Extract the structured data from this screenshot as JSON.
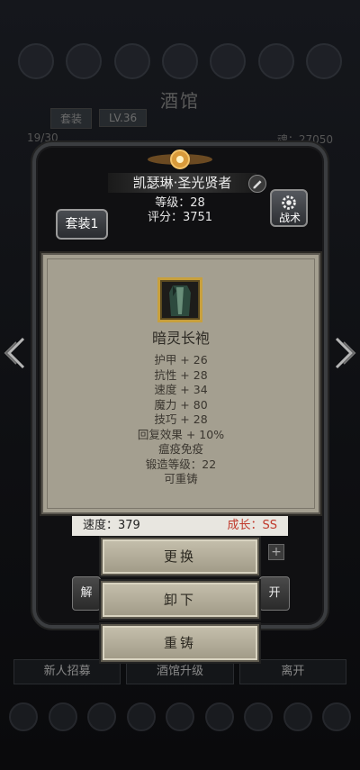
{
  "background": {
    "title": "酒馆",
    "tab_label": "套装",
    "level_badge": "LV.36",
    "count": "19/30",
    "soul": "魂：27050",
    "bottom_buttons": [
      "新人招募",
      "酒馆升级",
      "离开"
    ]
  },
  "hero": {
    "name": "凯瑟琳·圣光贤者",
    "level": "等级：28",
    "score": "评分：3751",
    "set_button": "套装1",
    "tactic_button": "战术"
  },
  "item": {
    "name": "暗灵长袍",
    "stats": [
      "护甲 + 26",
      "抗性 + 28",
      "速度 + 34",
      "魔力 + 80",
      "技巧 + 28",
      "回复效果 + 10%",
      "瘟疫免疫",
      "锻造等级：22",
      "可重铸"
    ]
  },
  "lower": {
    "speed": "速度：379",
    "growth": "成长：SS",
    "plus": "+",
    "left_partial": "解",
    "right_partial": "开"
  },
  "actions": {
    "replace": "更换",
    "unequip": "卸下",
    "reforge": "重铸"
  },
  "colors": {
    "panel_bg": "#a49f90",
    "item_border": "#c8a03c",
    "growth_red": "#c0392b"
  }
}
